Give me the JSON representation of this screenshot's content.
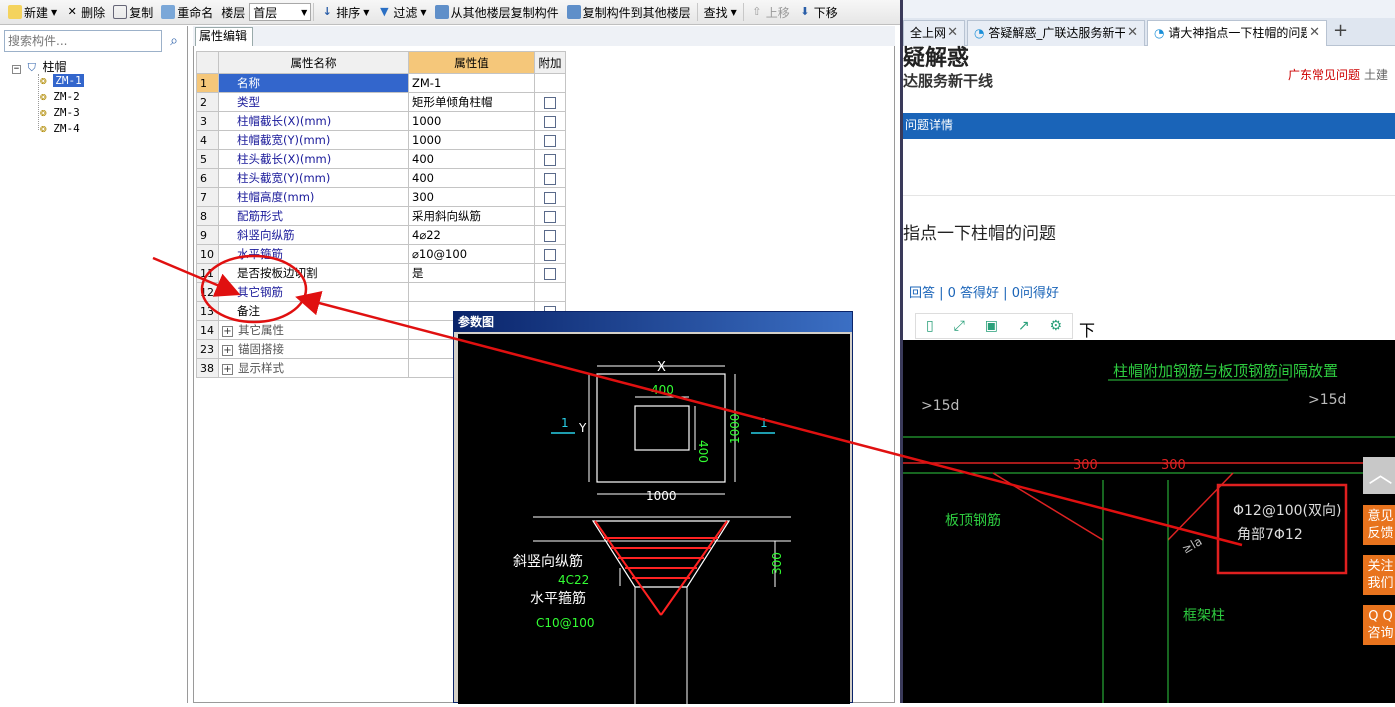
{
  "toolbar": {
    "new": "新建",
    "delete": "删除",
    "copy": "复制",
    "rename": "重命名",
    "floor_label": "楼层",
    "floor_value": "首层",
    "sort": "排序",
    "filter": "过滤",
    "copy_from_other": "从其他楼层复制构件",
    "copy_to_other": "复制构件到其他楼层",
    "find": "查找",
    "move_up": "上移",
    "move_down": "下移"
  },
  "search": {
    "placeholder": "搜索构件..."
  },
  "tree": {
    "root": "柱帽",
    "items": [
      "ZM-1",
      "ZM-2",
      "ZM-3",
      "ZM-4"
    ]
  },
  "prop_tab": "属性编辑",
  "grid": {
    "headers": {
      "name": "属性名称",
      "value": "属性值",
      "extra": "附加"
    },
    "rows": [
      {
        "n": "1",
        "name": "名称",
        "value": "ZM-1"
      },
      {
        "n": "2",
        "name": "类型",
        "value": "矩形单倾角柱帽"
      },
      {
        "n": "3",
        "name": "柱帽截长(X)(mm)",
        "value": "1000"
      },
      {
        "n": "4",
        "name": "柱帽截宽(Y)(mm)",
        "value": "1000"
      },
      {
        "n": "5",
        "name": "柱头截长(X)(mm)",
        "value": "400"
      },
      {
        "n": "6",
        "name": "柱头截宽(Y)(mm)",
        "value": "400"
      },
      {
        "n": "7",
        "name": "柱帽高度(mm)",
        "value": "300"
      },
      {
        "n": "8",
        "name": "配筋形式",
        "value": "采用斜向纵筋"
      },
      {
        "n": "9",
        "name": "斜竖向纵筋",
        "value": "4⌀22"
      },
      {
        "n": "10",
        "name": "水平箍筋",
        "value": "⌀10@100"
      },
      {
        "n": "11",
        "name": "是否按板边切割",
        "value": "是"
      },
      {
        "n": "12",
        "name": "其它钢筋",
        "value": ""
      },
      {
        "n": "13",
        "name": "备注",
        "value": ""
      },
      {
        "n": "14",
        "name": "其它属性",
        "value": ""
      },
      {
        "n": "23",
        "name": "锚固搭接",
        "value": ""
      },
      {
        "n": "38",
        "name": "显示样式",
        "value": ""
      }
    ]
  },
  "dialog": {
    "title": "参数图",
    "cad": {
      "x": "X",
      "y": "Y",
      "d400a": "400",
      "d400b": "400",
      "d1000a": "1000",
      "d1000b": "1000",
      "sec": "1",
      "sec2": "1",
      "slope_label": "斜竖向纵筋",
      "slope_val": "4C22",
      "hoop_label": "水平箍筋",
      "hoop_val": "C10@100",
      "h300": "300"
    }
  },
  "browser": {
    "tabs": [
      {
        "label": "全上网"
      },
      {
        "label": "答疑解惑_广联达服务新干线"
      },
      {
        "label": "请大神指点一下柱帽的问题"
      }
    ],
    "new_tab": "+",
    "logo1": "疑解惑",
    "logo2": "达服务新干线",
    "link1": "广东常见问题",
    "link2": "土建",
    "nav": "问题详情",
    "question": "指点一下柱帽的问题",
    "stats": "回答 | 0 答得好 | 0问得好",
    "after_icons": "下",
    "img": {
      "title": "柱帽附加钢筋与板顶钢筋间隔放置",
      "l15a": ">15d",
      "l15b": ">15d",
      "n300a": "300",
      "n300b": "300",
      "slab": "板顶钢筋",
      "frame": "框架柱",
      "note1": "Φ12@100(双向)",
      "note2": "角部7Φ12",
      "la": "≥la"
    },
    "side": {
      "feedback": [
        "意见",
        "反馈"
      ],
      "follow": [
        "关注",
        "我们"
      ],
      "qq": [
        "Q Q",
        "咨询"
      ]
    }
  },
  "colors": {
    "accent": "#1a64b8",
    "annotation": "#e01010",
    "header_value": "#f5c77a"
  }
}
